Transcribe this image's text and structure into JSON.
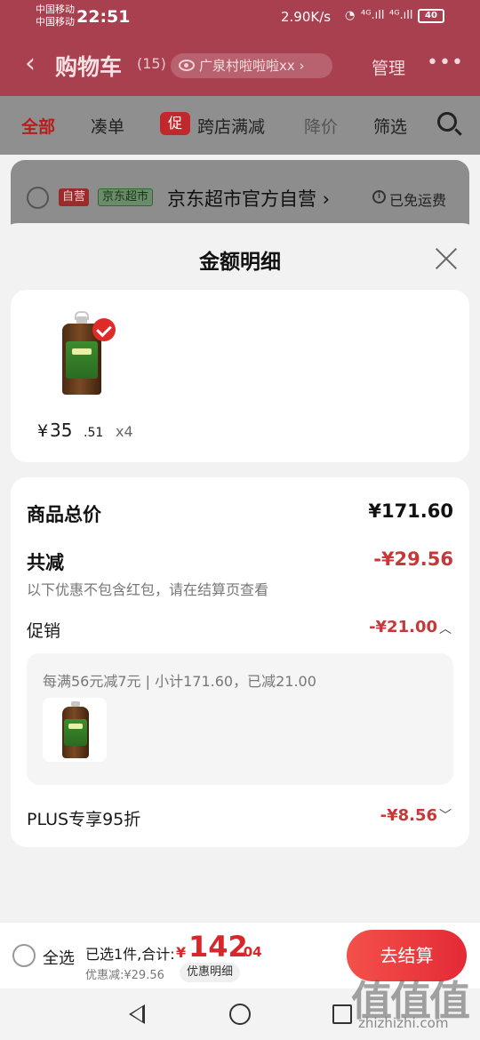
{
  "status_bar": {
    "carrier_1": "中国移动",
    "carrier_2": "中国移动",
    "time": "22:51",
    "net_speed": "2.90K/s",
    "signal_1": "⁴ᴳ.ıll",
    "signal_2": "⁴ᴳ.ıll",
    "battery": "40"
  },
  "header": {
    "back_icon": "chevron-left-icon",
    "title": "购物车",
    "count": "(15)",
    "address": "广泉村啦啦啦xx",
    "manage": "管理",
    "more_icon": "more-dots-icon"
  },
  "filter_tabs": {
    "all": "全部",
    "combine": "凑单",
    "promo_badge": "促",
    "cross_store": "跨店满减",
    "price_drop": "降价",
    "filter": "筛选"
  },
  "store": {
    "self_tag": "自营",
    "jd_tag": "京东超市",
    "name": "京东超市官方自营 ›",
    "shipping": "已免运费"
  },
  "sheet": {
    "title": "金额明细",
    "product": {
      "price_symbol": "¥",
      "price_int": "35",
      "price_dec": ".51",
      "quantity": "x4"
    },
    "total_label": "商品总价",
    "total_value": "¥171.60",
    "discount_label": "共减",
    "discount_value": "-¥29.56",
    "note": "以下优惠不包含红包，请在结算页查看",
    "promo_label": "促销",
    "promo_value": "-¥21.00",
    "promo_detail": "每满56元减7元 | 小计171.60，已减21.00",
    "plus_label": "PLUS专享95折",
    "plus_value": "-¥8.56"
  },
  "bottom_bar": {
    "select_all": "全选",
    "selected": "已选1件,合计:",
    "total_symbol": "¥",
    "total_int": "142",
    "total_dec": ".04",
    "saved": "优惠减:¥29.56",
    "detail_button": "优惠明细",
    "checkout": "去结算"
  },
  "watermark": {
    "glyphs": "值值值",
    "site": "zhizhizhi.com"
  },
  "colors": {
    "header_bg": "#a8404f",
    "price_red": "#d8262a",
    "discount_red": "#c73838",
    "checkout_red": "#e32a36"
  }
}
